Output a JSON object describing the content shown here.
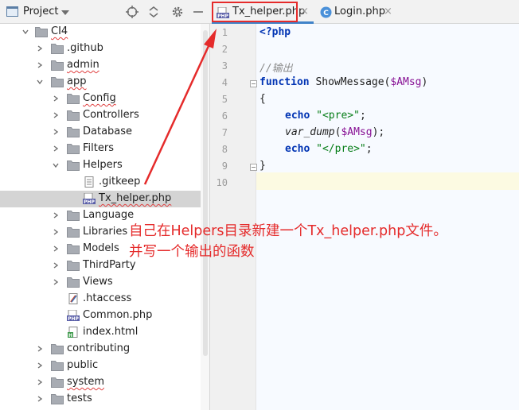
{
  "project_panel": {
    "title": "Project",
    "tree": [
      {
        "label": "CI4",
        "type": "folder",
        "open": true
      },
      {
        "label": ".github",
        "type": "folder",
        "open": false
      },
      {
        "label": "admin",
        "type": "folder",
        "open": false
      },
      {
        "label": "app",
        "type": "folder",
        "open": true
      },
      {
        "label": "Config",
        "type": "folder",
        "open": false
      },
      {
        "label": "Controllers",
        "type": "folder",
        "open": false
      },
      {
        "label": "Database",
        "type": "folder",
        "open": false
      },
      {
        "label": "Filters",
        "type": "folder",
        "open": false
      },
      {
        "label": "Helpers",
        "type": "folder",
        "open": true
      },
      {
        "label": ".gitkeep",
        "type": "text-file"
      },
      {
        "label": "Tx_helper.php",
        "type": "php-file",
        "selected": true
      },
      {
        "label": "Language",
        "type": "folder",
        "open": false
      },
      {
        "label": "Libraries",
        "type": "folder",
        "open": false
      },
      {
        "label": "Models",
        "type": "folder",
        "open": false
      },
      {
        "label": "ThirdParty",
        "type": "folder",
        "open": false
      },
      {
        "label": "Views",
        "type": "folder",
        "open": false
      },
      {
        "label": ".htaccess",
        "type": "htaccess-file"
      },
      {
        "label": "Common.php",
        "type": "php-file"
      },
      {
        "label": "index.html",
        "type": "html-file"
      },
      {
        "label": "contributing",
        "type": "folder",
        "open": false
      },
      {
        "label": "public",
        "type": "folder",
        "open": false
      },
      {
        "label": "system",
        "type": "folder",
        "open": false
      },
      {
        "label": "tests",
        "type": "folder",
        "open": false
      }
    ]
  },
  "editor": {
    "tabs": [
      {
        "label": "Tx_helper.php",
        "icon": "php-file-icon",
        "active": true
      },
      {
        "label": "Login.php",
        "icon": "php-class-icon",
        "active": false
      }
    ],
    "close_glyph": "×",
    "line_numbers": [
      "1",
      "2",
      "3",
      "4",
      "5",
      "6",
      "7",
      "8",
      "9",
      "10"
    ],
    "code": {
      "l1": "<?php",
      "l3": "//输出",
      "l4_kw": "function",
      "l4_fn": " ShowMessage(",
      "l4_var": "$AMsg",
      "l4_end": ")",
      "l5": "{",
      "l6_kw": "echo",
      "l6_str": "\"<pre>\"",
      "l6_end": ";",
      "l7_fn": "var_dump",
      "l7_open": "(",
      "l7_var": "$AMsg",
      "l7_end": ");",
      "l8_kw": "echo",
      "l8_str": "\"</pre>\"",
      "l8_end": ";",
      "l9": "}"
    }
  },
  "annotation": {
    "line1": "自己在Helpers目录新建一个Tx_helper.php文件。",
    "line2": "并写一个输出的函数",
    "color": "#e52b2b"
  },
  "colors": {
    "accent": "#4083c9",
    "keyword": "#0033b3",
    "string": "#067d17",
    "variable": "#871094",
    "comment": "#8c8c8c"
  }
}
